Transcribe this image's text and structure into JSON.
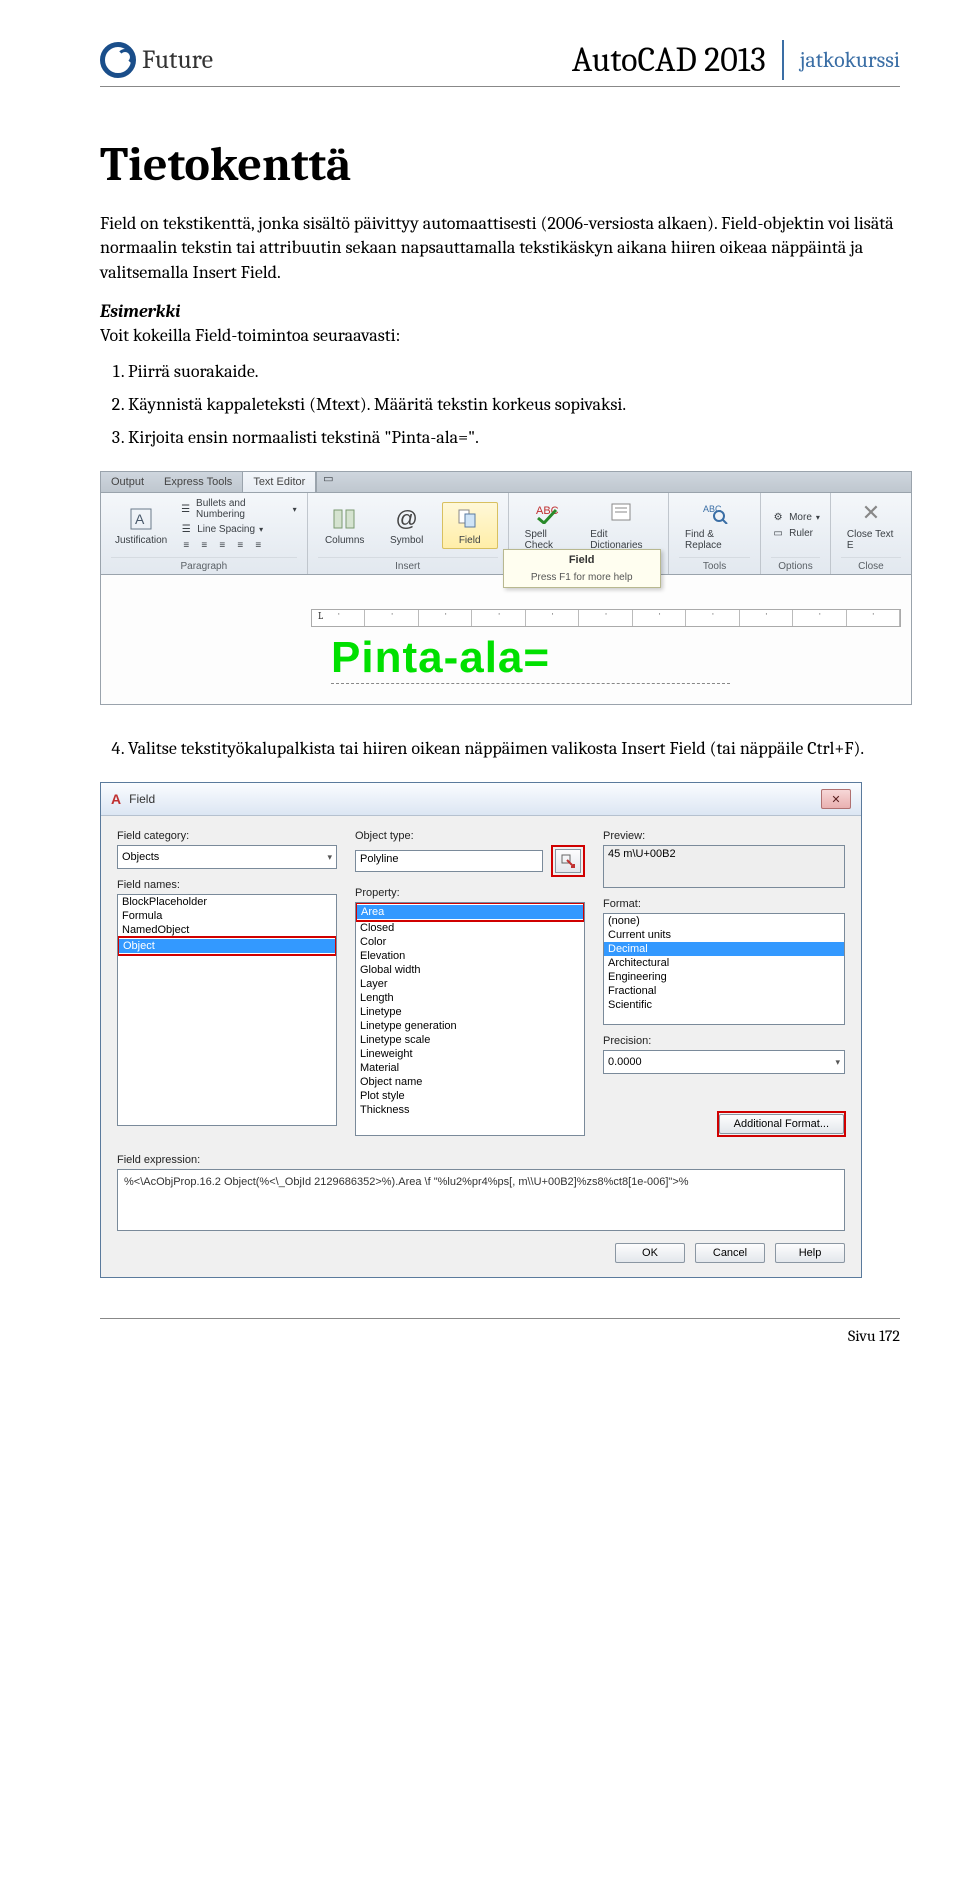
{
  "header": {
    "brand": "Future",
    "title": "AutoCAD 2013",
    "subtitle": "jatkokurssi"
  },
  "mainHeading": "Tietokenttä",
  "paragraphs": {
    "p1": "Field on tekstikenttä, jonka sisältö päivittyy automaattisesti (2006-versiosta alkaen). Field-objektin voi lisätä normaalin tekstin tai attribuutin sekaan napsauttamalla tekstikäskyn aikana hiiren oikeaa näppäintä ja valitsemalla Insert Field."
  },
  "exampleHeading": "Esimerkki",
  "exampleLead": "Voit kokeilla Field-toimintoa seuraavasti:",
  "steps": [
    "Piirrä suorakaide.",
    "Käynnistä kappaleteksti (Mtext). Määritä tekstin korkeus sopivaksi.",
    "Kirjoita ensin normaalisti tekstinä \"Pinta-ala=\"."
  ],
  "step4": "Valitse tekstityökalupalkista tai hiiren oikean näppäimen valikosta Insert Field (tai näppäile Ctrl+F).",
  "ribbon": {
    "tabs": {
      "output": "Output",
      "express": "Express Tools",
      "editor": "Text Editor"
    },
    "justification": "Justification",
    "paragraphStack": {
      "bullets": "Bullets and Numbering",
      "linespacing": "Line Spacing"
    },
    "panelLabels": {
      "paragraph": "Paragraph",
      "insert": "Insert",
      "tools": "Tools",
      "options": "Options",
      "close": "Close"
    },
    "bigButtons": {
      "columns": "Columns",
      "symbol": "Symbol",
      "field": "Field",
      "spell": "Spell Check",
      "edit": "Edit Dictionaries",
      "find": "Find & Replace",
      "more": "More",
      "ruler": "Ruler",
      "closeEditor": "Close Text E"
    },
    "tooltipTitle": "Field",
    "tooltipHint": "Press F1 for more help",
    "rulerLetter": "L",
    "pintaText": "Pinta-ala="
  },
  "dialog": {
    "title": "Field",
    "close": "✕",
    "labels": {
      "category": "Field category:",
      "fieldNames": "Field names:",
      "objectType": "Object type:",
      "property": "Property:",
      "preview": "Preview:",
      "format": "Format:",
      "precision": "Precision:",
      "expression": "Field expression:"
    },
    "category": "Objects",
    "fieldNames": [
      "BlockPlaceholder",
      "Formula",
      "NamedObject",
      "Object"
    ],
    "objectType": "Polyline",
    "properties": [
      "Area",
      "Closed",
      "Color",
      "Elevation",
      "Global width",
      "Layer",
      "Length",
      "Linetype",
      "Linetype generation",
      "Linetype scale",
      "Lineweight",
      "Material",
      "Object name",
      "Plot style",
      "Thickness"
    ],
    "preview": "45 m\\U+00B2",
    "formats": [
      "(none)",
      "Current units",
      "Decimal",
      "Architectural",
      "Engineering",
      "Fractional",
      "Scientific"
    ],
    "precision": "0.0000",
    "additionalFormat": "Additional Format...",
    "expression": "%<\\AcObjProp.16.2 Object(%<\\_ObjId 2129686352>%).Area \\f \"%lu2%pr4%ps[, m\\\\U+00B2]%zs8%ct8[1e-006]\">%",
    "buttons": {
      "ok": "OK",
      "cancel": "Cancel",
      "help": "Help"
    }
  },
  "footer": "Sivu 172"
}
